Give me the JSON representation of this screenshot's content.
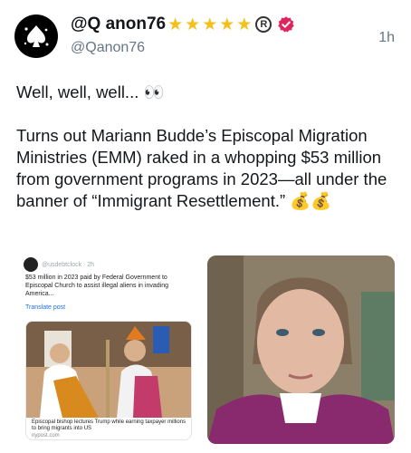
{
  "author": {
    "display_name": "@Q anon76",
    "handle": "@Qanon76",
    "stars": [
      "★",
      "★",
      "★",
      "★",
      "★"
    ],
    "registered_mark": "R",
    "avatar_icon": "spade-splash-icon",
    "verified_color": "#e0245e"
  },
  "timestamp": "1h",
  "post": {
    "line1": "Well, well, well... 👀",
    "line2": "Turns out Mariann Budde’s Episcopal Migration Ministries (EMM) raked in a whopping $53 million from government programs in 2023—all under the banner of “Immigrant Resettlement.” 💰💰"
  },
  "media": {
    "left": {
      "user": "@usdebtclock · 2h",
      "text": "$53 million in 2023 paid by Federal Government to Episcopal Church to assist illegal aliens in invading America...",
      "translate": "Translate post",
      "card_caption": "Episcopal bishop lectures Trump while earning taxpayer millions to bring migrants into US",
      "card_source": "nypost.com"
    },
    "right": {
      "description_icon": "portrait-photo"
    }
  }
}
